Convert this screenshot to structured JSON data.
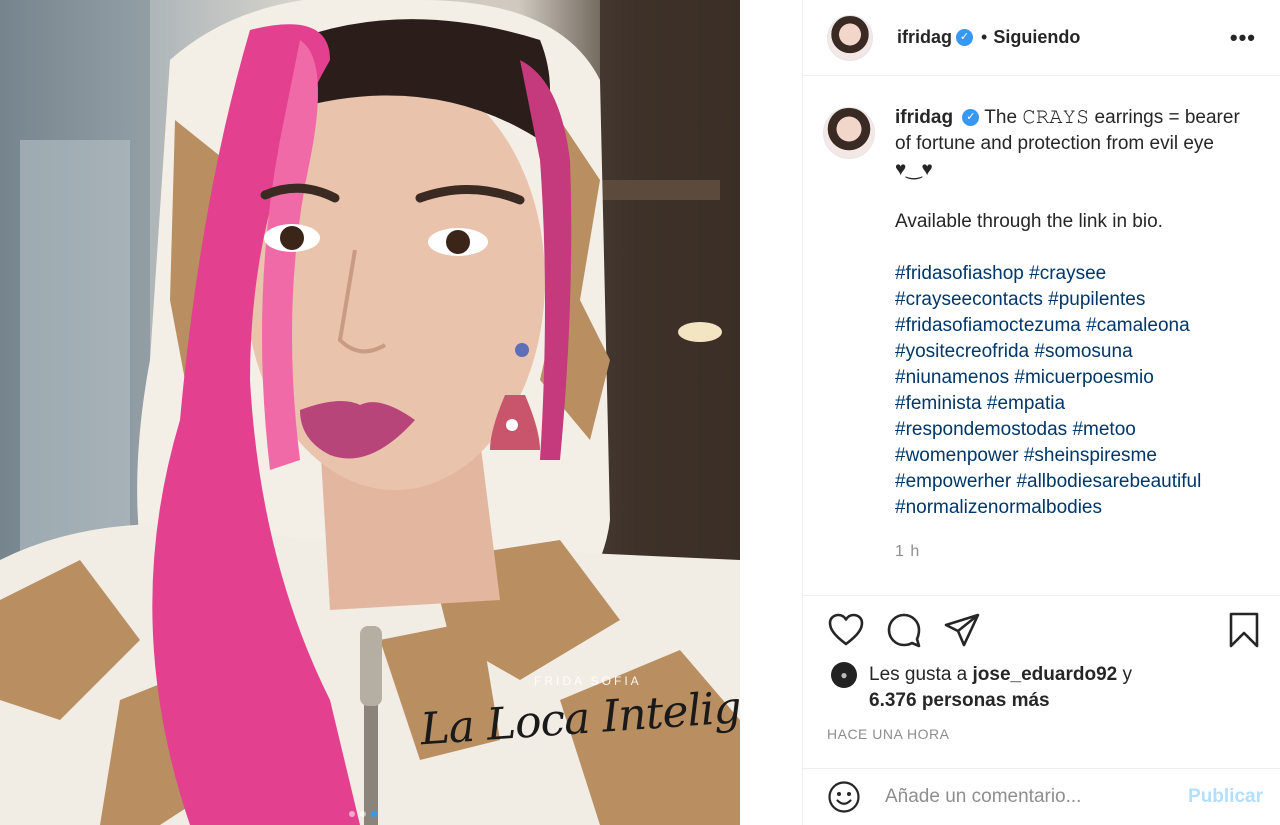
{
  "photo": {
    "brand_text": "FRIDA SOFIA",
    "script_text": "La Loca Inteligente",
    "carousel": {
      "count": 3,
      "active_index": 2
    }
  },
  "header": {
    "username": "ifridag",
    "verified_icon": "verified-badge-icon",
    "separator": "•",
    "follow_status": "Siguiendo",
    "more_label": "•••"
  },
  "caption": {
    "username": "ifridag",
    "line1": "The 𝙲𝚁𝙰𝚈𝚂 earrings = bearer of fortune and protection from evil eye ♥‿♥",
    "line2": "Available through the link in bio.",
    "hashtags": [
      [
        "#fridasofiashop",
        "#craysee"
      ],
      [
        "#crayseecontacts",
        "#pupilentes"
      ],
      [
        "#fridasofiamoctezuma",
        "#camaleona"
      ],
      [
        "#yositecreofrida",
        "#somosuna"
      ],
      [
        "#niunamenos",
        "#micuerpoesmio"
      ],
      [
        "#feminista",
        "#empatia"
      ],
      [
        "#respondemostodas",
        "#metoo"
      ],
      [
        "#womenpower",
        "#sheinspiresme"
      ],
      [
        "#empowerher",
        "#allbodiesarebeautiful"
      ],
      [
        "#normalizenormalbodies"
      ]
    ],
    "time": "1 h"
  },
  "actions": {
    "like_icon": "heart-icon",
    "comment_icon": "comment-icon",
    "share_icon": "share-icon",
    "save_icon": "bookmark-icon"
  },
  "likes": {
    "prefix": "Les gusta a ",
    "liker": "jose_eduardo92",
    "connector": " y",
    "others": "6.376 personas más"
  },
  "timestamp": "HACE UNA HORA",
  "comment": {
    "placeholder": "Añade un comentario...",
    "publish_label": "Publicar"
  },
  "colors": {
    "link": "#00376b",
    "verified": "#3897f0",
    "publish_disabled": "#b2dffc",
    "muted": "#8e8e8e"
  }
}
